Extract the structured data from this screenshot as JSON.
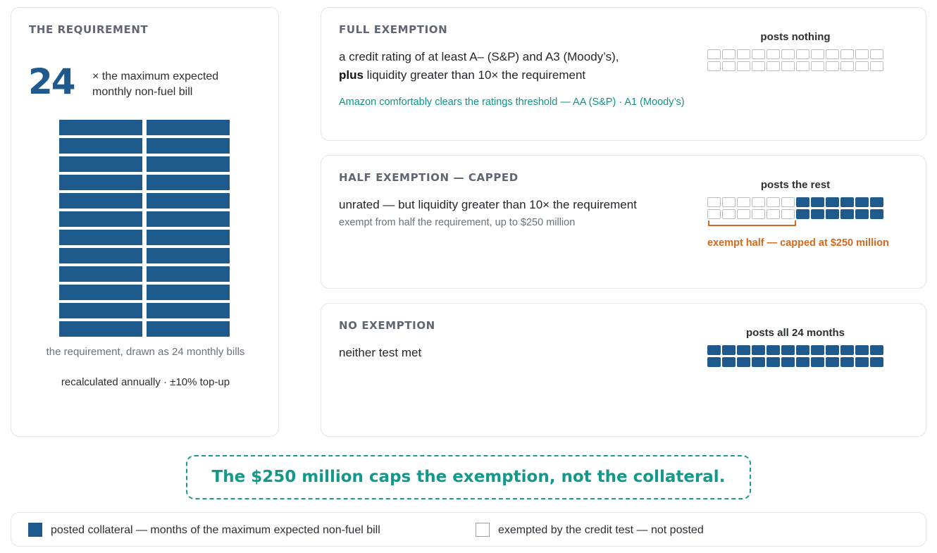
{
  "requirement": {
    "title": "THE REQUIREMENT",
    "number": "24",
    "description": "× the maximum expected monthly non-fuel bill",
    "bill_count": 24,
    "caption": "the requirement, drawn as 24 monthly bills",
    "note": "recalculated annually · ±10% top-up"
  },
  "full_exemption": {
    "title": "FULL EXEMPTION",
    "line1": "a credit rating of at least A– (S&P) and A3 (Moody’s),",
    "line2_bold": "plus",
    "line2_rest": " liquidity greater than 10× the requirement",
    "note": "Amazon comfortably clears the ratings threshold — AA (S&P) · A1 (Moody’s)",
    "grid_caption": "posts nothing",
    "posted_months": 0
  },
  "half_exemption": {
    "title": "HALF EXEMPTION — CAPPED",
    "main": "unrated — but liquidity greater than 10× the requirement",
    "sub": "exempt from half the requirement, up to $250 million",
    "grid_caption": "posts the rest",
    "posted_months": 12,
    "bracket_label": "exempt half — capped at $250 million"
  },
  "no_exemption": {
    "title": "NO EXEMPTION",
    "main": "neither test met",
    "grid_caption": "posts all 24 months",
    "posted_months": 24
  },
  "callout": "The $250 million caps the exemption, not the collateral.",
  "legend": {
    "filled": "posted collateral — months of the maximum expected non-fuel bill",
    "empty": "exempted by the credit test — not posted"
  },
  "colors": {
    "posted": "#1f5a8c",
    "exempt_border": "#b9bec5",
    "accent_teal": "#13988a",
    "accent_orange": "#d2691e"
  }
}
